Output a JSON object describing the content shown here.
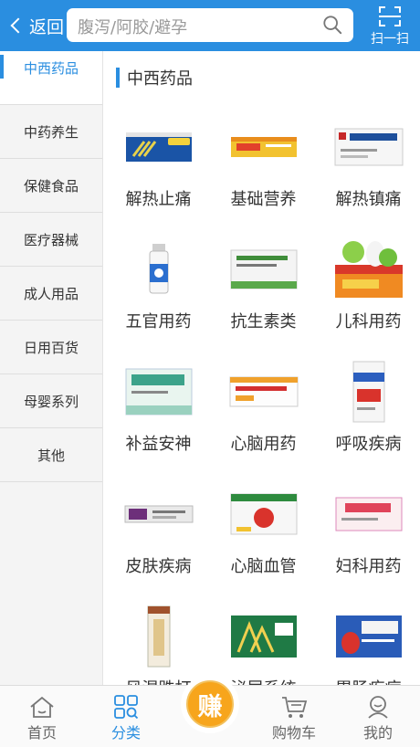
{
  "header": {
    "back_label": "返回",
    "search_placeholder": "腹泻/阿胶/避孕",
    "scan_label": "扫一扫"
  },
  "sidebar": {
    "items": [
      {
        "label": "中西药品",
        "active": true
      },
      {
        "label": "中药养生"
      },
      {
        "label": "保健食品"
      },
      {
        "label": "医疗器械"
      },
      {
        "label": "成人用品"
      },
      {
        "label": "日用百货"
      },
      {
        "label": "母婴系列"
      },
      {
        "label": "其他"
      }
    ]
  },
  "main": {
    "section_title": "中西药品",
    "categories": [
      {
        "label": "解热止痛",
        "icon": "medicine-box-blue-icon"
      },
      {
        "label": "基础营养",
        "icon": "medicine-box-orange-icon"
      },
      {
        "label": "解热镇痛",
        "icon": "medicine-box-white-icon"
      },
      {
        "label": "五官用药",
        "icon": "medicine-bottle-icon"
      },
      {
        "label": "抗生素类",
        "icon": "medicine-box-green-icon"
      },
      {
        "label": "儿科用药",
        "icon": "kids-medicine-box-icon"
      },
      {
        "label": "补益安神",
        "icon": "medicine-box-teal-icon"
      },
      {
        "label": "心脑用药",
        "icon": "medicine-box-orange-stripe-icon"
      },
      {
        "label": "呼吸疾病",
        "icon": "medicine-box-red-blue-icon"
      },
      {
        "label": "皮肤疾病",
        "icon": "ointment-tube-icon"
      },
      {
        "label": "心脑血管",
        "icon": "medicine-box-red-green-icon"
      },
      {
        "label": "妇科用药",
        "icon": "medicine-box-pink-icon"
      },
      {
        "label": "风湿跌打",
        "icon": "medicine-box-tall-icon"
      },
      {
        "label": "泌尿系统",
        "icon": "medicine-box-green-gold-icon"
      },
      {
        "label": "胃肠疾病",
        "icon": "medicine-box-blue-red-icon"
      }
    ]
  },
  "bottom_nav": {
    "home": "首页",
    "category": "分类",
    "earn": "赚",
    "cart": "购物车",
    "mine": "我的"
  }
}
